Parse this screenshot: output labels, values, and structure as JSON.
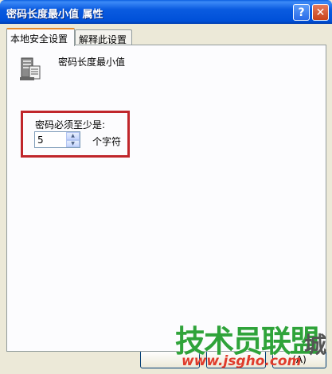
{
  "window": {
    "title": "密码长度最小值 属性",
    "help_button": "?",
    "close_button": "✕"
  },
  "tabs": [
    {
      "label": "本地安全设置",
      "active": true
    },
    {
      "label": "解释此设置",
      "active": false
    }
  ],
  "policy": {
    "icon": "policy-server-icon",
    "name": "密码长度最小值"
  },
  "setting": {
    "label": "密码必须至少是:",
    "value": "5",
    "unit": "个字符"
  },
  "footer": {
    "apply_partial": "(A)"
  },
  "watermark": {
    "main": "技术员联盟",
    "extra": "城",
    "url": "www.jsgho.com"
  },
  "colors": {
    "highlight": "#c0262b",
    "titlebar": "#0a5be0",
    "watermark_green": "#2fa33a",
    "watermark_red": "#e03b2b"
  }
}
